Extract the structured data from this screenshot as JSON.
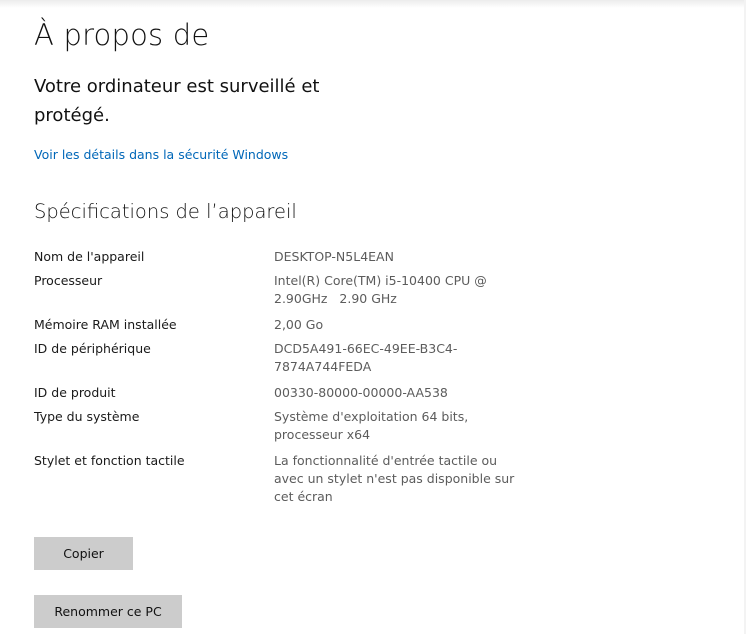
{
  "page": {
    "title": "À propos de"
  },
  "protection": {
    "status": "Votre ordinateur est surveillé et protégé.",
    "link_label": "Voir les détails dans la sécurité Windows"
  },
  "specifications": {
    "heading": "Spécifications de l’appareil",
    "rows": [
      {
        "label": "Nom de l'appareil",
        "value": "DESKTOP-N5L4EAN"
      },
      {
        "label": "Processeur",
        "value": "Intel(R) Core(TM) i5-10400 CPU @ 2.90GHz   2.90 GHz"
      },
      {
        "label": "Mémoire RAM installée",
        "value": "2,00 Go"
      },
      {
        "label": "ID de périphérique",
        "value": "DCD5A491-66EC-49EE-B3C4-7874A744FEDA"
      },
      {
        "label": "ID de produit",
        "value": "00330-80000-00000-AA538"
      },
      {
        "label": "Type du système",
        "value": "Système d'exploitation 64 bits, processeur x64"
      },
      {
        "label": "Stylet et fonction tactile",
        "value": "La fonctionnalité d'entrée tactile ou avec un stylet n'est pas disponible sur cet écran"
      }
    ]
  },
  "actions": {
    "copy_label": "Copier",
    "rename_label": "Renommer ce PC"
  },
  "colors": {
    "link": "#0067b8",
    "button_bg": "#cccccc",
    "value_text": "#5c5c5c"
  }
}
